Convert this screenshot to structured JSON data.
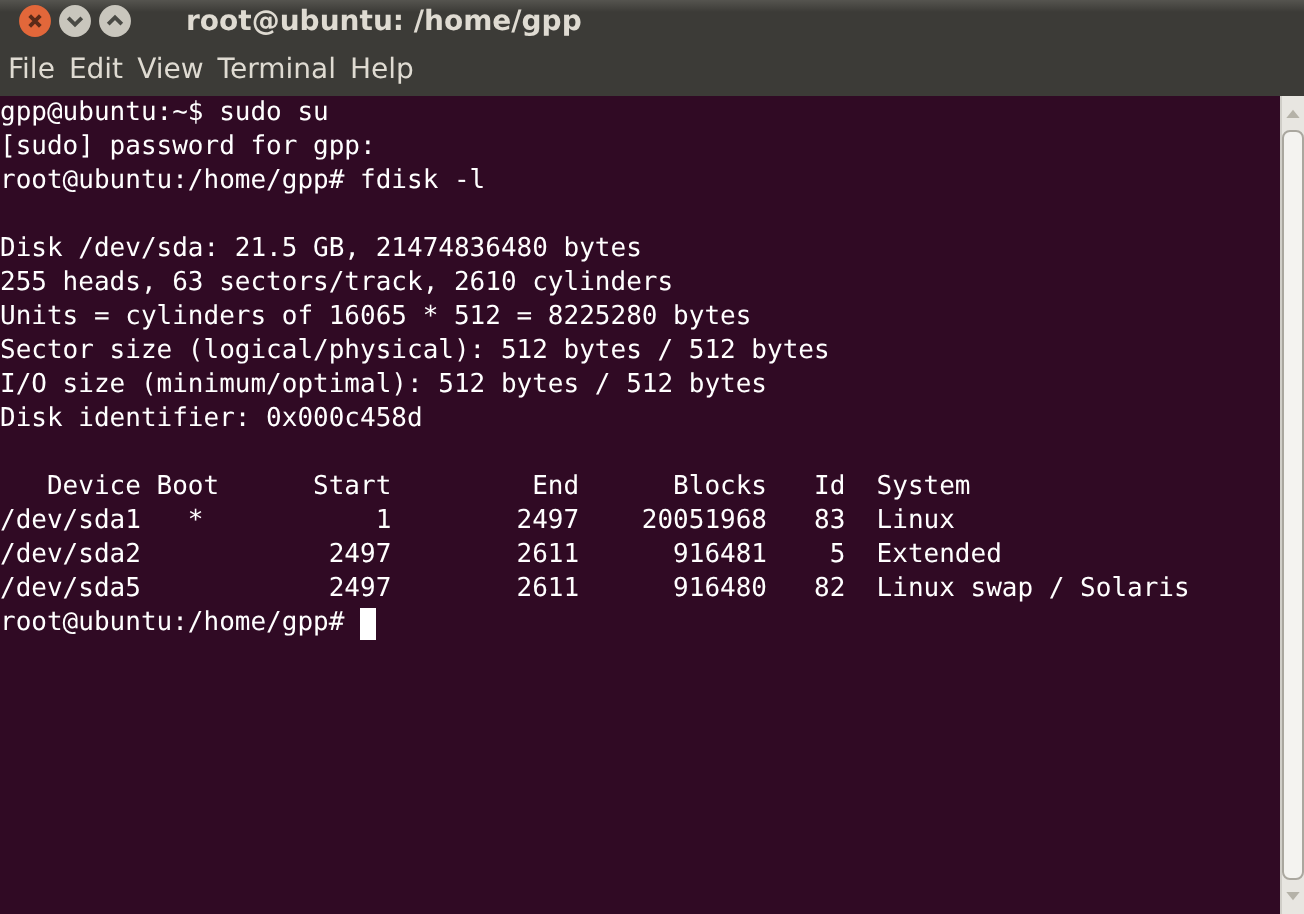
{
  "window": {
    "title": "root@ubuntu: /home/gpp"
  },
  "menu": [
    "File",
    "Edit",
    "View",
    "Terminal",
    "Help"
  ],
  "terminal": {
    "blocks": [
      [
        "gpp@ubuntu:~$ sudo su",
        "[sudo] password for gpp:",
        "root@ubuntu:/home/gpp# fdisk -l"
      ],
      [
        "Disk /dev/sda: 21.5 GB, 21474836480 bytes",
        "255 heads, 63 sectors/track, 2610 cylinders",
        "Units = cylinders of 16065 * 512 = 8225280 bytes",
        "Sector size (logical/physical): 512 bytes / 512 bytes",
        "I/O size (minimum/optimal): 512 bytes / 512 bytes",
        "Disk identifier: 0x000c458d"
      ],
      [
        "   Device Boot      Start         End      Blocks   Id  System",
        "/dev/sda1   *           1        2497    20051968   83  Linux",
        "/dev/sda2            2497        2611      916481    5  Extended",
        "/dev/sda5            2497        2611      916480   82  Linux swap / Solaris"
      ]
    ],
    "prompt": {
      "text": "root@ubuntu:/home/gpp#",
      "cursor": true
    }
  }
}
